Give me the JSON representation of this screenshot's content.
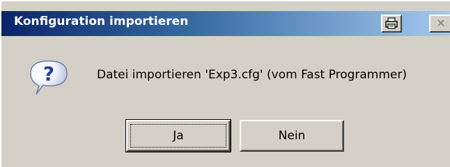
{
  "dialog": {
    "title": "Konfiguration importieren",
    "message": "Datei importieren 'Exp3.cfg' (vom Fast Programmer)",
    "icon": "question-icon",
    "titlebar_buttons": [
      {
        "name": "print-icon"
      },
      {
        "name": "close-icon",
        "glyph": "✕"
      }
    ],
    "buttons": {
      "yes_label": "Ja",
      "no_label": "Nein"
    }
  },
  "colors": {
    "titlebar_start": "#0a246a",
    "titlebar_end": "#a6caf0",
    "face": "#d4d0c8"
  }
}
